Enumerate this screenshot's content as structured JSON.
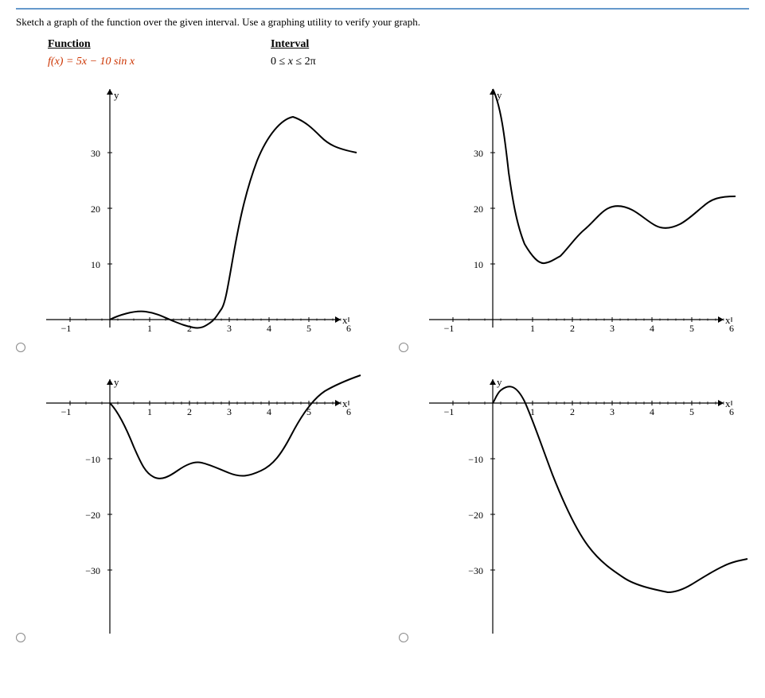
{
  "instructions": "Sketch a graph of the function over the given interval. Use a graphing utility to verify your graph.",
  "header": {
    "function_label": "Function",
    "interval_label": "Interval"
  },
  "function": {
    "expr": "f(x) = 5x − 10 sin x",
    "interval": "0 ≤ x ≤ 2π"
  },
  "graphs": [
    {
      "id": "top-left",
      "type": "correct",
      "selected": false
    },
    {
      "id": "top-right",
      "type": "correct-answer",
      "selected": false
    },
    {
      "id": "bottom-left",
      "type": "wrong1",
      "selected": false
    },
    {
      "id": "bottom-right",
      "type": "wrong2",
      "selected": false
    }
  ]
}
